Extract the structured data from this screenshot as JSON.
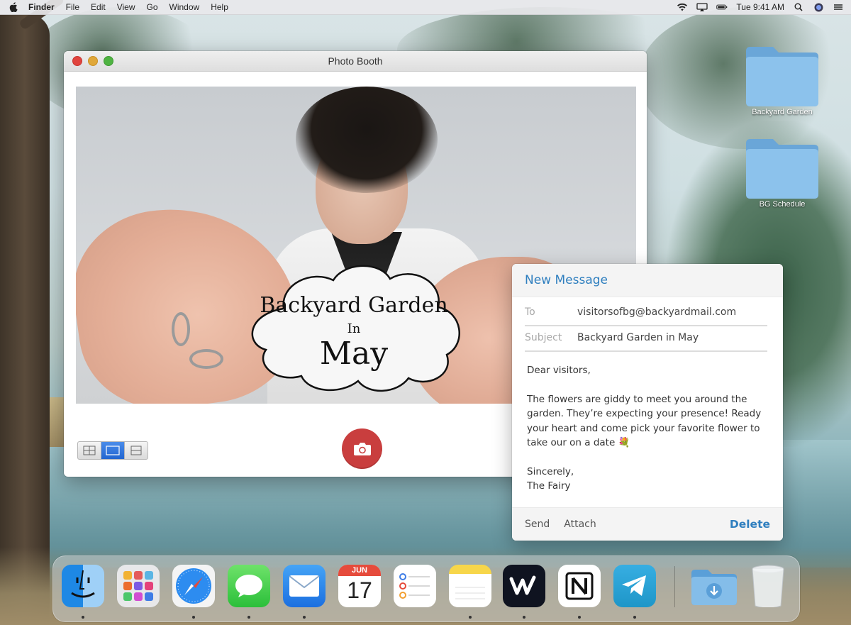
{
  "menubar": {
    "items": [
      "Finder",
      "File",
      "Edit",
      "View",
      "Go",
      "Window",
      "Help"
    ],
    "clock": "Tue 9:41 AM"
  },
  "photobooth": {
    "window_title": "Photo Booth",
    "overlay": {
      "line1": "Backyard Garden",
      "line2": "In",
      "line3": "May"
    }
  },
  "desktop": {
    "folders": [
      {
        "label": "Backyard Garden"
      },
      {
        "label": "BG Schedule"
      }
    ]
  },
  "message": {
    "title": "New Message",
    "to_label": "To",
    "to_value": "visitorsofbg@backyardmail.com",
    "subject_label": "Subject",
    "subject_value": "Backyard Garden in May",
    "greeting": "Dear visitors,",
    "paragraph": "The flowers are giddy to meet you around the garden. They’re expecting your presence! Ready your heart and come pick your favorite flower to take our on a date 💐",
    "signoff": "Sincerely,",
    "signature": "The Fairy",
    "send_label": "Send",
    "attach_label": "Attach",
    "delete_label": "Delete"
  },
  "dock": {
    "calendar_month": "JUN",
    "calendar_day": "17",
    "apps": [
      "finder-icon",
      "launchpad-icon",
      "safari-icon",
      "messages-icon",
      "mail-icon",
      "calendar-icon",
      "reminders-icon",
      "notes-icon",
      "weverse-icon",
      "notion-icon",
      "telegram-icon",
      "downloads-folder-icon",
      "trash-icon"
    ]
  },
  "colors": {
    "accent_blue": "#2f7fbf",
    "shutter_red": "#c93e3e"
  }
}
